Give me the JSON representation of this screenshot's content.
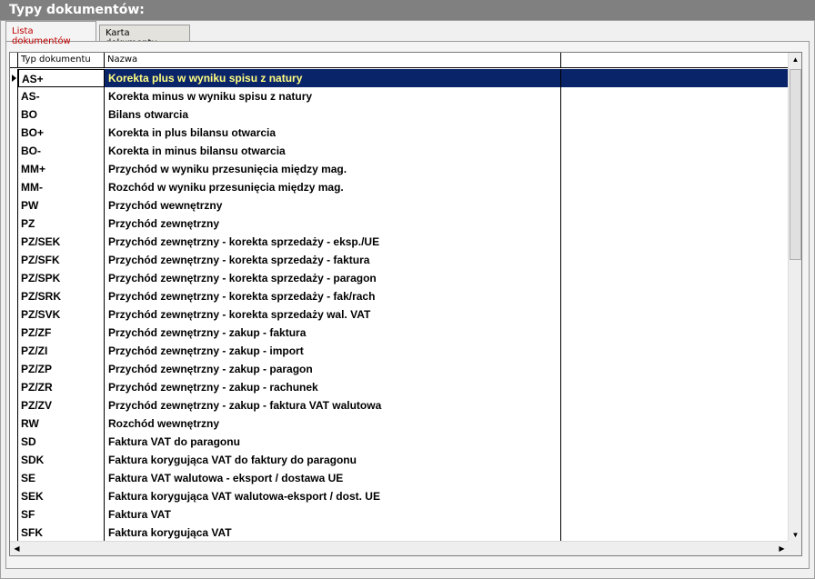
{
  "window": {
    "title": "Typy dokumentów:"
  },
  "tabs": [
    {
      "label": "Lista dokumentów",
      "active": true
    },
    {
      "label": "Karta dokumentu",
      "active": false
    }
  ],
  "grid": {
    "columns": [
      "Typ dokumentu",
      "Nazwa"
    ],
    "selected_index": 0,
    "rows": [
      {
        "typ": "AS+",
        "nazwa": "Korekta plus w wyniku spisu z natury"
      },
      {
        "typ": "AS-",
        "nazwa": "Korekta minus w wyniku spisu z natury"
      },
      {
        "typ": "BO",
        "nazwa": "Bilans otwarcia"
      },
      {
        "typ": "BO+",
        "nazwa": "Korekta in plus bilansu otwarcia"
      },
      {
        "typ": "BO-",
        "nazwa": "Korekta in minus bilansu otwarcia"
      },
      {
        "typ": "MM+",
        "nazwa": "Przychód w wyniku przesunięcia między mag."
      },
      {
        "typ": "MM-",
        "nazwa": "Rozchód w wyniku przesunięcia między mag."
      },
      {
        "typ": "PW",
        "nazwa": "Przychód wewnętrzny"
      },
      {
        "typ": "PZ",
        "nazwa": "Przychód zewnętrzny"
      },
      {
        "typ": "PZ/SEK",
        "nazwa": "Przychód zewnętrzny - korekta sprzedaży - eksp./UE"
      },
      {
        "typ": "PZ/SFK",
        "nazwa": "Przychód zewnętrzny - korekta sprzedaży - faktura"
      },
      {
        "typ": "PZ/SPK",
        "nazwa": "Przychód zewnętrzny - korekta sprzedaży - paragon"
      },
      {
        "typ": "PZ/SRK",
        "nazwa": "Przychód zewnętrzny - korekta sprzedaży - fak/rach"
      },
      {
        "typ": "PZ/SVK",
        "nazwa": "Przychód zewnętrzny - korekta sprzedaży wal. VAT"
      },
      {
        "typ": "PZ/ZF",
        "nazwa": "Przychód zewnętrzny - zakup - faktura"
      },
      {
        "typ": "PZ/ZI",
        "nazwa": "Przychód zewnętrzny - zakup - import"
      },
      {
        "typ": "PZ/ZP",
        "nazwa": "Przychód zewnętrzny - zakup - paragon"
      },
      {
        "typ": "PZ/ZR",
        "nazwa": "Przychód zewnętrzny - zakup - rachunek"
      },
      {
        "typ": "PZ/ZV",
        "nazwa": "Przychód zewnętrzny - zakup - faktura VAT walutowa"
      },
      {
        "typ": "RW",
        "nazwa": "Rozchód wewnętrzny"
      },
      {
        "typ": "SD",
        "nazwa": "Faktura VAT do paragonu"
      },
      {
        "typ": "SDK",
        "nazwa": "Faktura korygująca VAT do faktury do paragonu"
      },
      {
        "typ": "SE",
        "nazwa": "Faktura VAT walutowa - eksport / dostawa UE"
      },
      {
        "typ": "SEK",
        "nazwa": "Faktura korygująca VAT walutowa-eksport / dost. UE"
      },
      {
        "typ": "SF",
        "nazwa": "Faktura VAT"
      },
      {
        "typ": "SFK",
        "nazwa": "Faktura korygująca VAT"
      }
    ]
  },
  "scrollbars": {
    "up_icon": "triangle-up-icon",
    "down_icon": "triangle-down-icon",
    "left_icon": "triangle-left-icon",
    "right_icon": "triangle-right-icon"
  },
  "colors": {
    "selection_bg": "#0a246a",
    "selection_text": "#ffff80",
    "active_tab_text": "#c00000",
    "titlebar_bg": "#808080"
  }
}
